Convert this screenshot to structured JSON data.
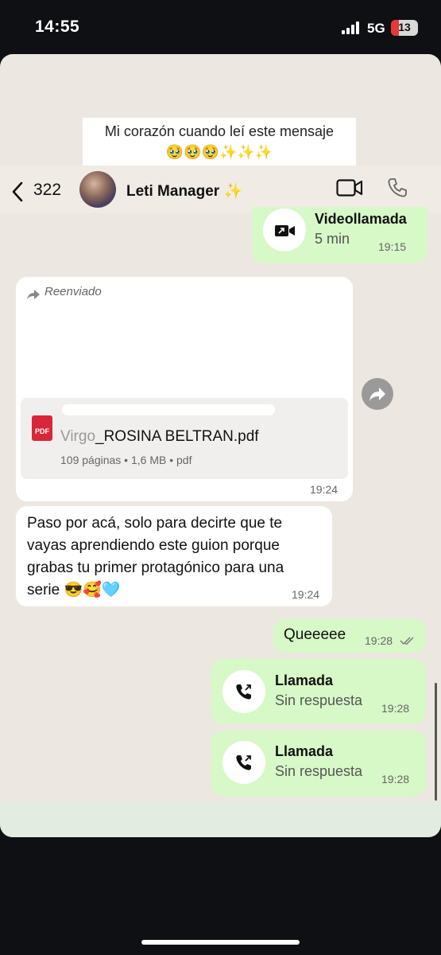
{
  "status_bar": {
    "time": "14:55",
    "network": "5G",
    "battery": "13"
  },
  "caption": {
    "line1": "Mi corazón cuando leí este mensaje",
    "line2": "🥹🥹🥹✨✨✨"
  },
  "header": {
    "back_count": "322",
    "contact_name": "Leti Manager",
    "contact_emoji": "✨"
  },
  "messages": {
    "video_call": {
      "title": "Videollamada",
      "duration": "5 min",
      "time": "19:15"
    },
    "forwarded_doc": {
      "forwarded_label": "Reenviado",
      "file_name": "Virgo_ROSINA BELTRAN.pdf",
      "file_name_visible": "...ROSINA BELTRAN.pdf",
      "meta": "109 páginas • 1,6 MB • pdf",
      "icon_label": "PDF",
      "time": "19:24"
    },
    "text_in": {
      "line1": "Paso por acá, solo para decirte que te",
      "line2": "vayas aprendiendo este guion porque",
      "line3": "grabas tu primer protagónico para una",
      "line4": "serie 😎🥰🩵",
      "time": "19:24"
    },
    "text_out": {
      "text": "Queeeee",
      "time": "19:28"
    },
    "missed_call_1": {
      "title": "Llamada",
      "subtitle": "Sin respuesta",
      "time": "19:28"
    },
    "missed_call_2": {
      "title": "Llamada",
      "subtitle": "Sin respuesta",
      "time": "19:28"
    }
  },
  "colors": {
    "outgoing_bubble": "#d7f8c7",
    "incoming_bubble": "#ffffff",
    "chat_background": "#ece8e1",
    "pdf_red": "#d9263a"
  }
}
